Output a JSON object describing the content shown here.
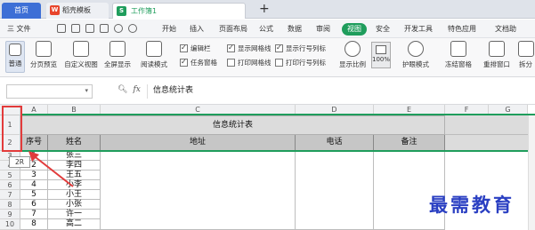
{
  "tabs": {
    "home": "首页",
    "templates": "稻壳模板",
    "workbook": "工作簿1",
    "new_tab": "+"
  },
  "menu": {
    "file": "三 文件",
    "items": [
      "开始",
      "插入",
      "页面布局",
      "公式",
      "数据",
      "审阅",
      "视图",
      "安全",
      "开发工具",
      "特色应用",
      "文档助"
    ],
    "active": "视图"
  },
  "ribbon": {
    "normal": "普通",
    "page_preview": "分页预览",
    "custom_view": "自定义视图",
    "fullscreen": "全屏显示",
    "reading_mode": "阅读模式",
    "edit_bar": "编辑栏",
    "task_pane": "任务窗格",
    "show_gridlines": "显示网格线",
    "print_gridlines": "打印网格线",
    "show_rowcol": "显示行号列标",
    "print_rowcol": "打印行号列标",
    "zoom": "显示比例",
    "zoom_value": "100%",
    "eye_mode": "护眼模式",
    "freeze": "冻结窗格",
    "rearrange": "重排窗口",
    "split": "拆分"
  },
  "formula_bar": {
    "fx": "fx",
    "content": "信息统计表"
  },
  "sheet": {
    "columns": [
      "A",
      "B",
      "C",
      "D",
      "E",
      "F",
      "G"
    ],
    "title": "信息统计表",
    "headers": [
      "序号",
      "姓名",
      "地址",
      "电话",
      "备注"
    ],
    "row_numbers": [
      "1",
      "2",
      "3",
      "4",
      "5",
      "6",
      "7",
      "8",
      "9",
      "10"
    ],
    "rows": [
      [
        "1",
        "张三"
      ],
      [
        "2",
        "李四"
      ],
      [
        "3",
        "王五"
      ],
      [
        "4",
        "小李"
      ],
      [
        "5",
        "小王"
      ],
      [
        "6",
        "小张"
      ],
      [
        "7",
        "许一"
      ],
      [
        "8",
        "高二"
      ]
    ]
  },
  "tooltip": "2R",
  "watermark": "最需教育",
  "colors": {
    "accent": "#1f9d5c",
    "highlight": "#e23b3b",
    "tab_home": "#3d6fd6",
    "watermark": "#2a3fc2"
  }
}
